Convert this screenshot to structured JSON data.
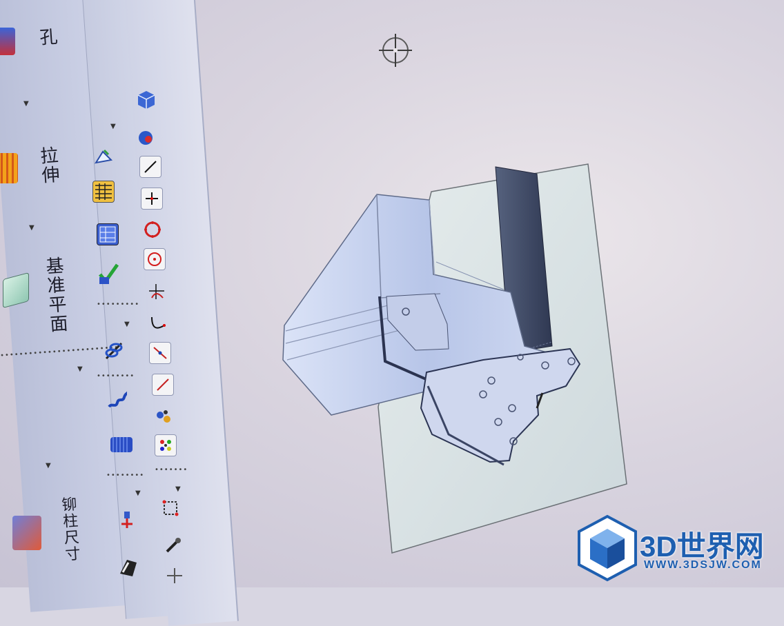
{
  "ribbon": {
    "hole_label": "孔",
    "extrude_label": "拉伸",
    "datum_plane_label": "基准平面",
    "rivet_dimension_label": "铆柱尺寸"
  },
  "tools": {
    "column_b": [
      "view-cube-icon",
      "sketch-icon",
      "table-icon",
      "matrix-icon",
      "check-icon",
      "spring-tool-icon",
      "spring-icon",
      "coil-icon",
      "axis-tool-icon",
      "chair-icon"
    ],
    "column_c": [
      "display-icon",
      "globe-icon",
      "line-icon",
      "point-icon",
      "circle-icon",
      "target-icon",
      "vertex-icon",
      "curve-icon",
      "segment-icon",
      "diagonal-icon",
      "parts-icon",
      "palette-icon",
      "frame-icon",
      "tools-icon"
    ]
  },
  "watermark": {
    "brand": "3D世界网",
    "url": "WWW.3DSJW.COM",
    "accent": "#1e5fb0"
  },
  "colors": {
    "model_face": "#c7d2ea",
    "model_shadow": "#3a4563",
    "plate": "#d7dfe3"
  }
}
